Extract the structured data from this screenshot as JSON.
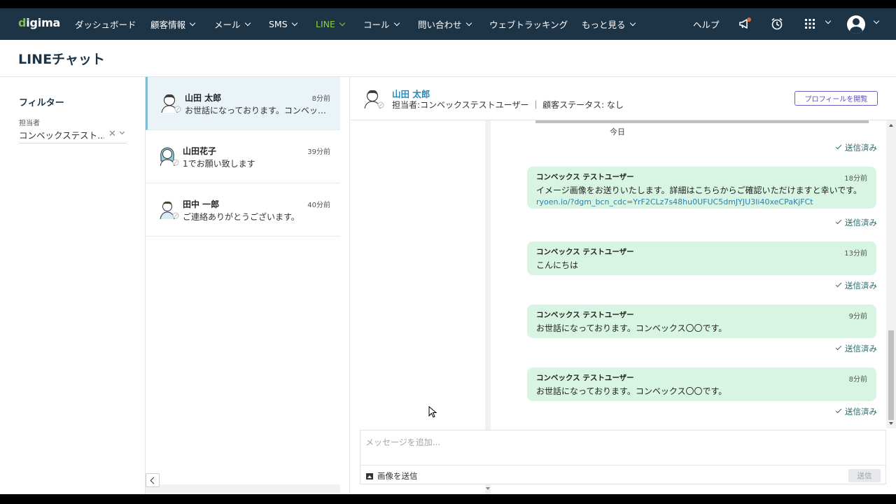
{
  "brand": {
    "logo": "digima"
  },
  "nav": {
    "items": [
      {
        "label": "ダッシュボード"
      },
      {
        "label": "顧客情報"
      },
      {
        "label": "メール"
      },
      {
        "label": "SMS"
      },
      {
        "label": "LINE"
      },
      {
        "label": "コール"
      },
      {
        "label": "問い合わせ"
      },
      {
        "label": "ウェブトラッキング"
      },
      {
        "label": "もっと見る"
      },
      {
        "label": "ヘルプ"
      }
    ],
    "active": "LINE",
    "icons": [
      "megaphone-icon",
      "alarm-clock-icon",
      "apps-grid-icon",
      "user-avatar-icon"
    ]
  },
  "page": {
    "title": "LINEチャット"
  },
  "filter": {
    "title": "フィルター",
    "assignee_label": "担当者",
    "assignee_value": "コンベックステスト..."
  },
  "conversations": [
    {
      "name": "山田 太郎",
      "time": "8分前",
      "preview": "お世話になっております。コンベックス〇〇です。",
      "active": true
    },
    {
      "name": "山田花子",
      "time": "39分前",
      "preview": "1でお願い致します",
      "active": false
    },
    {
      "name": "田中 一郎",
      "time": "40分前",
      "preview": "ご連絡ありがとうございます。",
      "active": false
    }
  ],
  "chat": {
    "contact_name": "山田 太郎",
    "meta": "担当者:コンベックステストユーザー ｜ 顧客ステータス: なし",
    "profile_button": "プロフィールを開覧",
    "today_label": "今日",
    "sent_label": "送信済み",
    "messages": [
      {
        "sender": "コンベックス テストユーザー",
        "time": "18分前",
        "text": "イメージ画像をお送りいたします。詳細はこちらからご確認いただけますと幸いです。",
        "link": "ryoen.io/?dgm_bcn_cdc=YrF2CLz7s48hu0UFUC5dmJYJU3Ii40xeCPaKjFCt"
      },
      {
        "sender": "コンベックス テストユーザー",
        "time": "13分前",
        "text": "こんにちは"
      },
      {
        "sender": "コンベックス テストユーザー",
        "time": "9分前",
        "text": "お世話になっております。コンベックス〇〇です。"
      },
      {
        "sender": "コンベックス テストユーザー",
        "time": "8分前",
        "text": "お世話になっております。コンベックス〇〇です。"
      }
    ],
    "composer_placeholder": "メッセージを追加...",
    "image_send_label": "画像を送信",
    "send_label": "送信"
  },
  "colors": {
    "nav_bg": "#1d3447",
    "nav_active": "#8bd12f",
    "bubble": "#d8f5e4",
    "accent_link": "#2a88b6",
    "profile_btn": "#5b4fbf"
  }
}
